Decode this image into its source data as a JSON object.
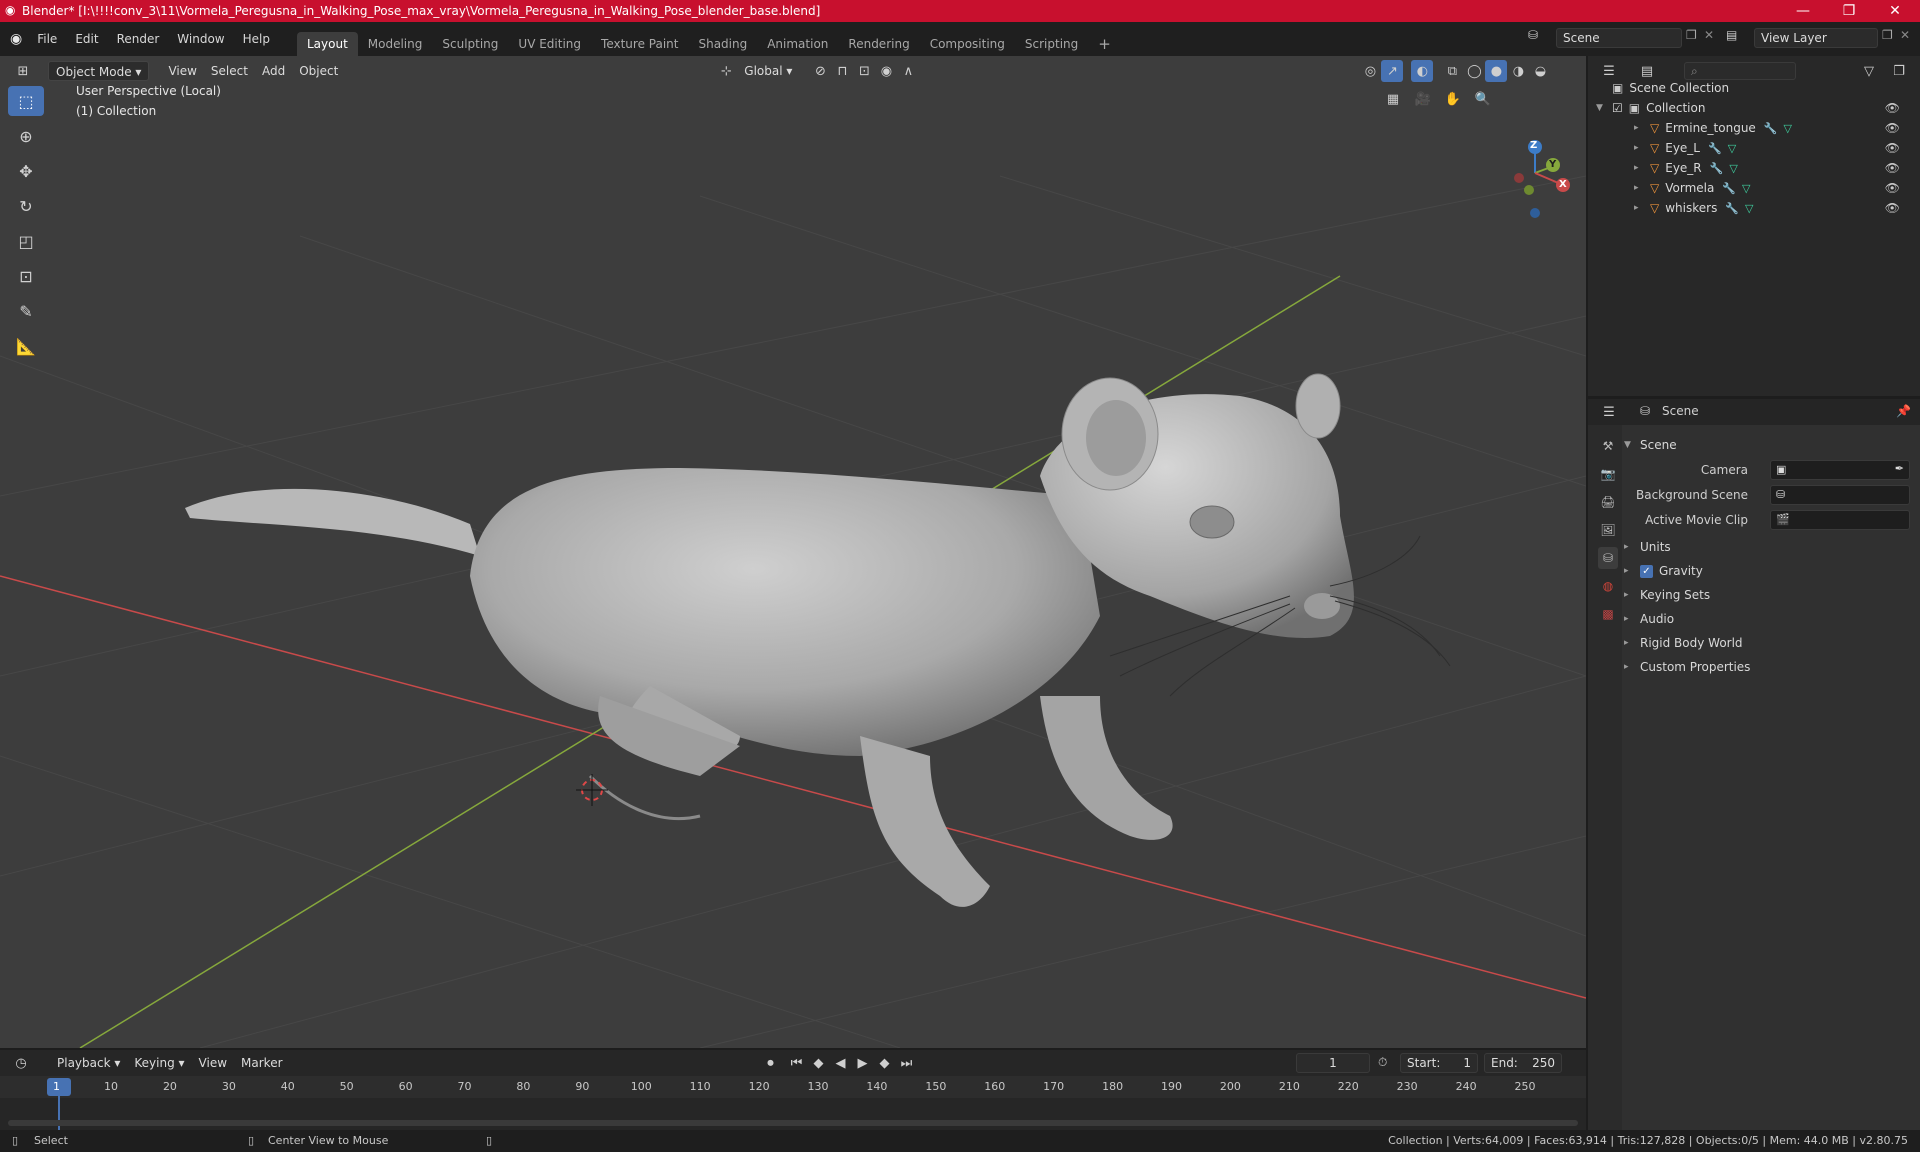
{
  "window": {
    "title": "Blender* [I:\\!!!!conv_3\\11\\Vormela_Peregusna_in_Walking_Pose_max_vray\\Vormela_Peregusna_in_Walking_Pose_blender_base.blend]",
    "minimize": "—",
    "maximize": "❐",
    "close": "✕"
  },
  "menu": [
    "File",
    "Edit",
    "Render",
    "Window",
    "Help"
  ],
  "workspaces": [
    {
      "label": "Layout",
      "active": true
    },
    {
      "label": "Modeling"
    },
    {
      "label": "Sculpting"
    },
    {
      "label": "UV Editing"
    },
    {
      "label": "Texture Paint"
    },
    {
      "label": "Shading"
    },
    {
      "label": "Animation"
    },
    {
      "label": "Rendering"
    },
    {
      "label": "Compositing"
    },
    {
      "label": "Scripting"
    }
  ],
  "add_workspace": "+",
  "scene_selector": {
    "value": "Scene"
  },
  "view_layer_selector": {
    "value": "View Layer"
  },
  "viewport": {
    "mode": "Object Mode",
    "menus": [
      "View",
      "Select",
      "Add",
      "Object"
    ],
    "transform_orientation": "Global",
    "perspective_label": "User Perspective (Local)",
    "collection_label": "(1) Collection",
    "gizmo": {
      "x": "X",
      "y": "Y",
      "z": "Z"
    }
  },
  "outliner": {
    "search_placeholder": "",
    "root": "Scene Collection",
    "collection": "Collection",
    "objects": [
      "Ermine_tongue",
      "Eye_L",
      "Eye_R",
      "Vormela",
      "whiskers"
    ]
  },
  "properties": {
    "header": "Scene",
    "panel_title": "Scene",
    "fields": [
      {
        "label": "Camera"
      },
      {
        "label": "Background Scene"
      },
      {
        "label": "Active Movie Clip"
      }
    ],
    "sections": [
      {
        "label": "Units"
      },
      {
        "label": "Gravity",
        "checked": true
      },
      {
        "label": "Keying Sets"
      },
      {
        "label": "Audio"
      },
      {
        "label": "Rigid Body World"
      },
      {
        "label": "Custom Properties"
      }
    ]
  },
  "timeline": {
    "menus": [
      "Playback",
      "Keying",
      "View",
      "Marker"
    ],
    "current_frame": "1",
    "start_label": "Start:",
    "start_value": "1",
    "end_label": "End:",
    "end_value": "250",
    "ticks": [
      "1",
      "10",
      "20",
      "30",
      "40",
      "50",
      "60",
      "70",
      "80",
      "90",
      "100",
      "110",
      "120",
      "130",
      "140",
      "150",
      "160",
      "170",
      "180",
      "190",
      "200",
      "210",
      "220",
      "230",
      "240",
      "250"
    ]
  },
  "status": {
    "left_action": "Select",
    "middle_action": "Center View to Mouse",
    "stats": "Collection | Verts:64,009 | Faces:63,914 | Tris:127,828 | Objects:0/5 | Mem: 44.0 MB | v2.80.75"
  },
  "colors": {
    "titlebar": "#c8102e",
    "accent": "#4772b3",
    "x_axis": "#c84a4a",
    "y_axis": "#86a83c"
  }
}
